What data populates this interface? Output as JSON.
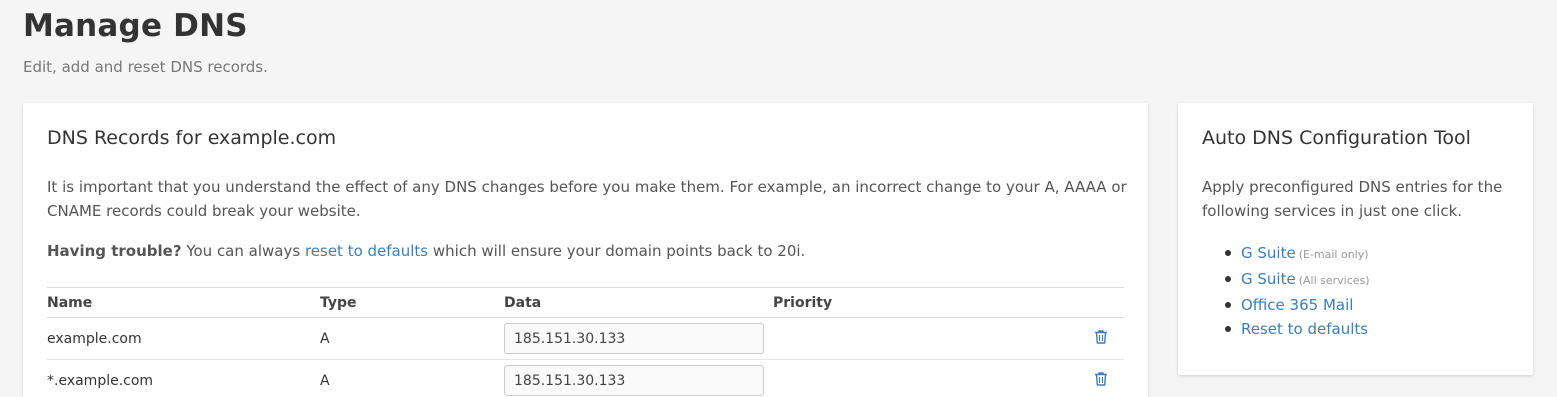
{
  "header": {
    "title": "Manage DNS",
    "subtitle": "Edit, add and reset DNS records."
  },
  "main": {
    "title": "DNS Records for example.com",
    "intro": "It is important that you understand the effect of any DNS changes before you make them. For example, an incorrect change to your A, AAAA or CNAME records could break your website.",
    "trouble_bold": "Having trouble?",
    "trouble_pre": " You can always ",
    "trouble_link": "reset to defaults",
    "trouble_post": " which will ensure your domain points back to 20i.",
    "columns": {
      "name": "Name",
      "type": "Type",
      "data": "Data",
      "priority": "Priority"
    },
    "rows": [
      {
        "name": "example.com",
        "type": "A",
        "data": "185.151.30.133",
        "priority": ""
      },
      {
        "name": "*.example.com",
        "type": "A",
        "data": "185.151.30.133",
        "priority": ""
      }
    ]
  },
  "side": {
    "title": "Auto DNS Configuration Tool",
    "intro": "Apply preconfigured DNS entries for the following services in just one click.",
    "services": [
      {
        "label": "G Suite",
        "note": "(E-mail only)"
      },
      {
        "label": "G Suite",
        "note": "(All services)"
      },
      {
        "label": "Office 365 Mail",
        "note": ""
      },
      {
        "label": "Reset to defaults",
        "note": ""
      }
    ]
  },
  "colors": {
    "link": "#3a7fb8",
    "background": "#f5f5f5",
    "card": "#ffffff"
  },
  "icons": {
    "delete": "trash-icon"
  }
}
